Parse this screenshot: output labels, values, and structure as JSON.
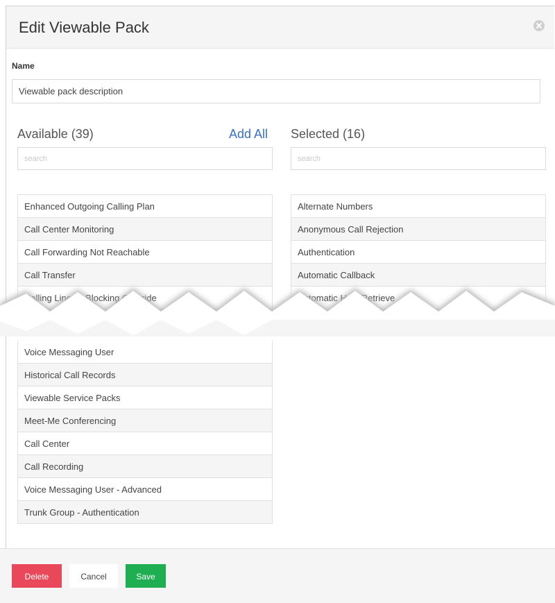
{
  "dialog": {
    "title": "Edit Viewable Pack",
    "close_icon": "close-circle-icon"
  },
  "name_field": {
    "label": "Name",
    "value": "Viewable pack description"
  },
  "available": {
    "title": "Available (39)",
    "add_all_label": "Add All",
    "search_placeholder": "search",
    "items_top": [
      "Enhanced Outgoing Calling Plan",
      "Call Center Monitoring",
      "Call Forwarding Not Reachable",
      "Call Transfer",
      "Calling Line ID Blocking Override"
    ],
    "items_bottom": [
      "Voice Messaging User",
      "Historical Call Records",
      "Viewable Service Packs",
      "Meet-Me Conferencing",
      "Call Center",
      "Call Recording",
      "Voice Messaging User - Advanced",
      "Trunk Group - Authentication"
    ]
  },
  "selected": {
    "title": "Selected (16)",
    "search_placeholder": "search",
    "items_top": [
      "Alternate Numbers",
      "Anonymous Call Rejection",
      "Authentication",
      "Automatic Callback",
      "Automatic Hold/Retrieve"
    ]
  },
  "footer": {
    "delete_label": "Delete",
    "cancel_label": "Cancel",
    "save_label": "Save"
  },
  "colors": {
    "accent_link": "#3b6fbf",
    "delete": "#e8485a",
    "save": "#1fae51"
  }
}
